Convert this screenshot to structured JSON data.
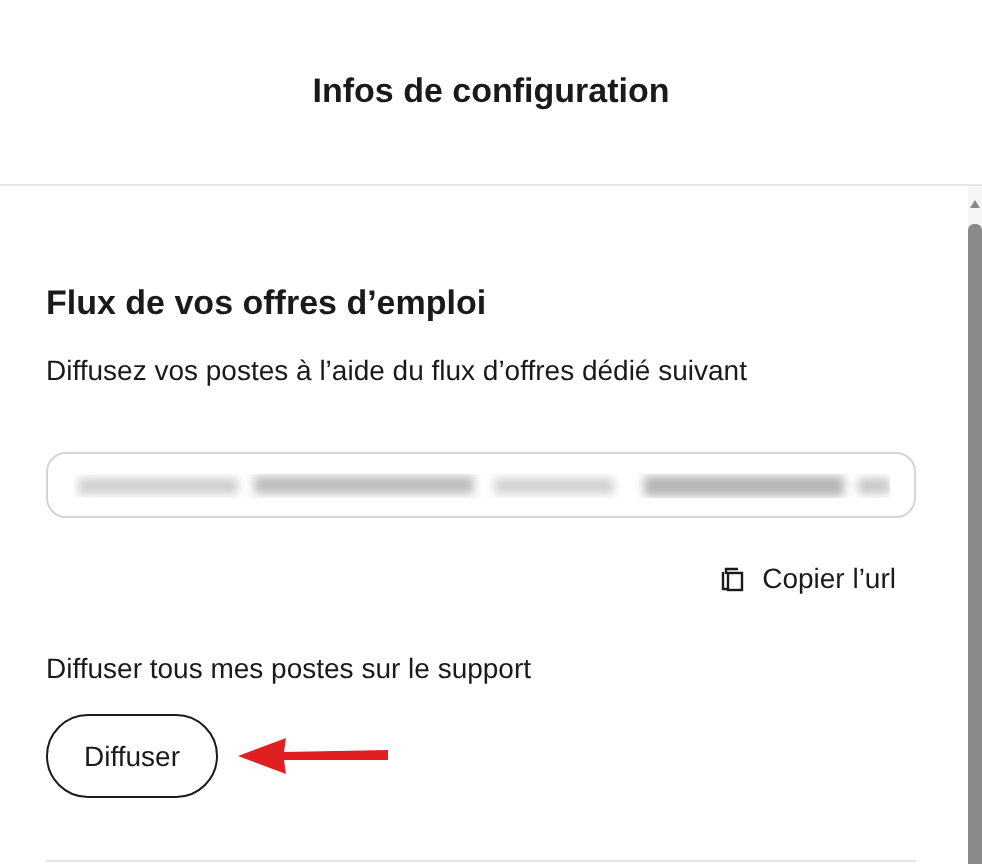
{
  "dialog": {
    "title": "Infos de configuration"
  },
  "section": {
    "heading": "Flux de vos offres d’emploi",
    "description": "Diffusez vos postes à l’aide du flux d’offres dédié suivant"
  },
  "url_field": {
    "kind": "redacted"
  },
  "copy_link": {
    "label": "Copier l’url"
  },
  "broadcast": {
    "label": "Diffuser tous mes postes sur le support",
    "button": "Diffuser"
  },
  "annotation": {
    "kind": "arrow",
    "color": "#e02020"
  }
}
